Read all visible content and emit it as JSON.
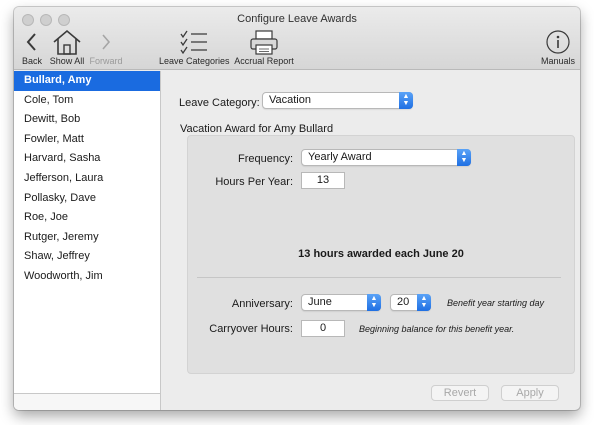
{
  "window": {
    "title": "Configure Leave Awards"
  },
  "toolbar": {
    "back": {
      "label": "Back",
      "icon": "chevron-left-icon"
    },
    "show_all": {
      "label": "Show All",
      "icon": "house-icon"
    },
    "forward": {
      "label": "Forward",
      "icon": "chevron-right-icon",
      "disabled": true
    },
    "leave_categories": {
      "label": "Leave Categories",
      "icon": "checklist-icon"
    },
    "accrual_report": {
      "label": "Accrual Report",
      "icon": "printer-icon"
    },
    "manuals": {
      "label": "Manuals",
      "icon": "info-icon"
    }
  },
  "sidebar": {
    "items": [
      {
        "label": "Bullard, Amy",
        "selected": true
      },
      {
        "label": "Cole, Tom"
      },
      {
        "label": "Dewitt, Bob"
      },
      {
        "label": "Fowler, Matt"
      },
      {
        "label": "Harvard, Sasha"
      },
      {
        "label": "Jefferson, Laura"
      },
      {
        "label": "Pollasky, Dave"
      },
      {
        "label": "Roe, Joe"
      },
      {
        "label": "Rutger, Jeremy"
      },
      {
        "label": "Shaw, Jeffrey"
      },
      {
        "label": "Woodworth, Jim"
      }
    ]
  },
  "main": {
    "leave_category_label": "Leave Category:",
    "leave_category_value": "Vacation",
    "section_title": "Vacation Award for Amy Bullard",
    "frequency_label": "Frequency:",
    "frequency_value": "Yearly Award",
    "hours_per_year_label": "Hours Per Year:",
    "hours_per_year_value": "13",
    "summary": "13 hours awarded each June 20",
    "anniversary_label": "Anniversary:",
    "anniversary_month": "June",
    "anniversary_day": "20",
    "anniversary_hint": "Benefit year starting day",
    "carryover_label": "Carryover Hours:",
    "carryover_value": "0",
    "carryover_hint": "Beginning balance for this benefit year.",
    "revert_label": "Revert",
    "apply_label": "Apply"
  },
  "colors": {
    "accent": "#1a6be0",
    "popup_arrow": "#2f7ff0"
  }
}
